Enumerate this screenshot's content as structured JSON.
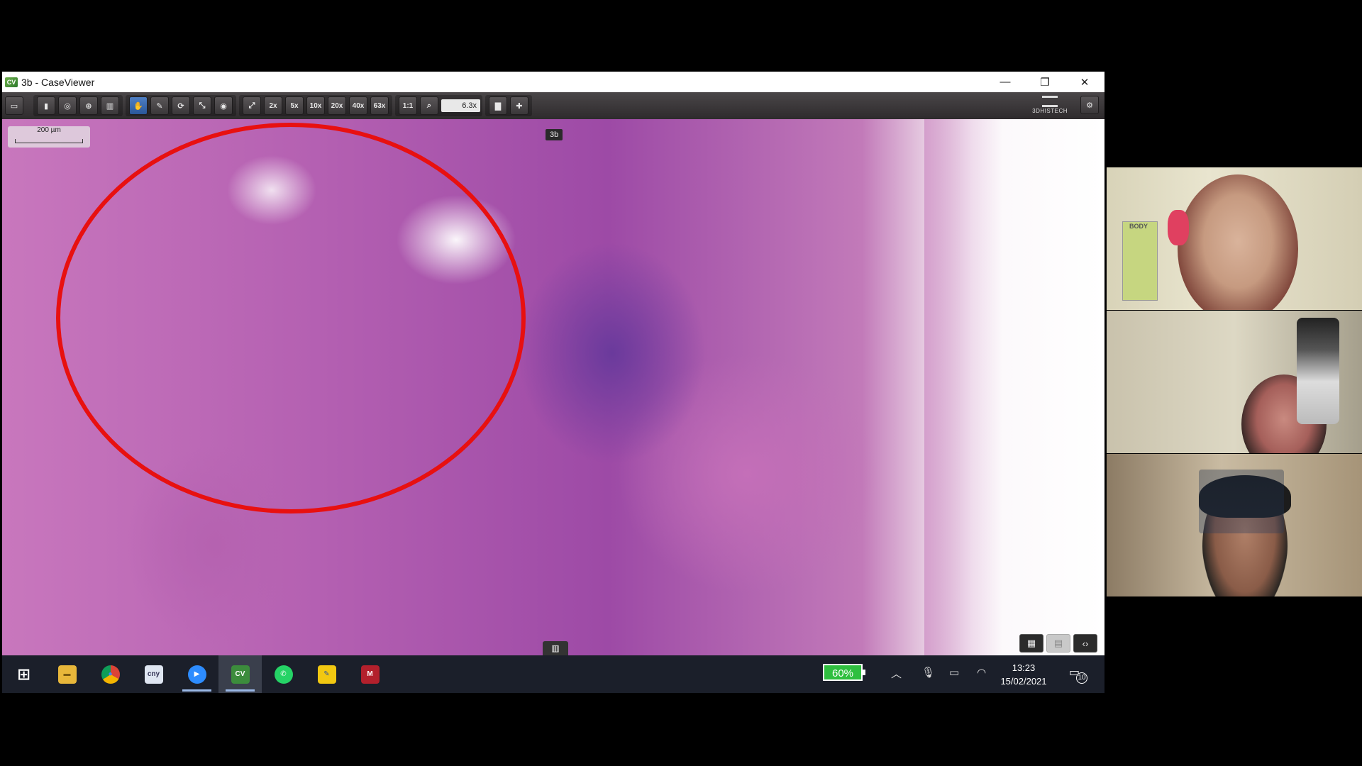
{
  "window": {
    "title": "3b - CaseViewer",
    "logo_text": "CV",
    "controls": [
      "—",
      "❐",
      "✕"
    ]
  },
  "toolbar": {
    "zoom_presets": [
      "2x",
      "5x",
      "10x",
      "20x",
      "40x",
      "63x"
    ],
    "one_to_one": "1:1",
    "zoom_value": "6.3x",
    "brand": "3DHISTECH"
  },
  "slide": {
    "scale_bar": "200 µm",
    "slide_label": "3b",
    "annotation_color": "#e81010"
  },
  "taskbar": {
    "apps": [
      {
        "name": "start",
        "glyph": "⊞"
      },
      {
        "name": "file-explorer",
        "glyph": "▬"
      },
      {
        "name": "chrome",
        "glyph": "●"
      },
      {
        "name": "cny",
        "glyph": "cny"
      },
      {
        "name": "zoom",
        "glyph": "▶"
      },
      {
        "name": "caseviewer",
        "glyph": "CV"
      },
      {
        "name": "whatsapp",
        "glyph": "✆"
      },
      {
        "name": "sticky",
        "glyph": "✎"
      },
      {
        "name": "mendeley",
        "glyph": "M"
      }
    ],
    "battery": "60%",
    "time": "13:23",
    "date": "15/02/2021",
    "notifications": "10"
  },
  "video": {
    "poster_text": "BODY"
  }
}
